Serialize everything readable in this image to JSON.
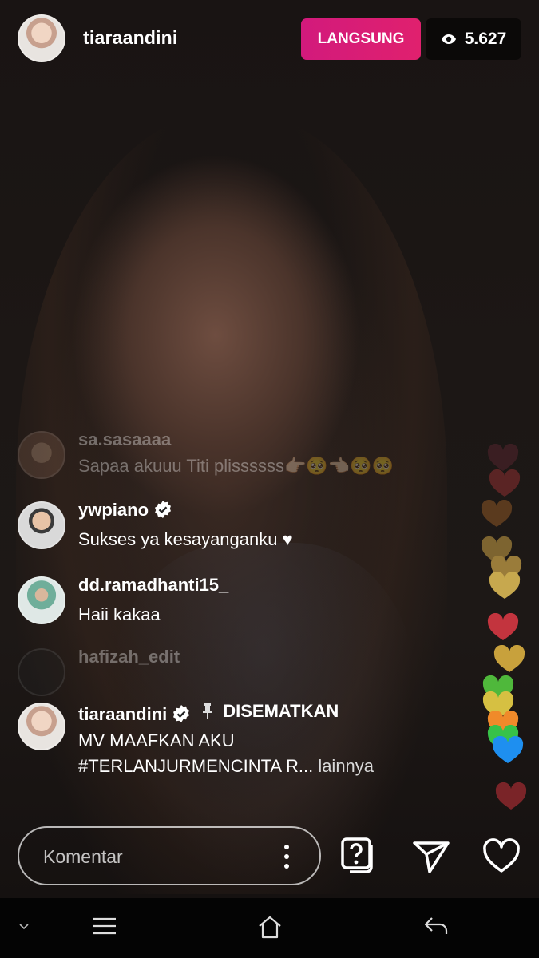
{
  "header": {
    "username": "tiaraandini",
    "live_label": "LANGSUNG",
    "viewer_count": "5.627",
    "viewer_icon": "eye-icon"
  },
  "comments": [
    {
      "username": "sa.sasaaaa",
      "text": "Sapaa akuuu Titi plissssss👉🏻🥺👈🏻🥺🥺",
      "faded": true
    },
    {
      "username": "ywpiano",
      "text": "Sukses ya kesayanganku ♥",
      "verified": true
    },
    {
      "username": "dd.ramadhanti15_",
      "text": "Haii kakaa"
    },
    {
      "username": "hafizah_edit",
      "text": "",
      "faded": true
    }
  ],
  "pinned_comment": {
    "username": "tiaraandini",
    "verified": true,
    "pinned_label": "DISEMATKAN",
    "line1": "MV MAAFKAN AKU",
    "line2": "#TERLANJURMENCINTA R...",
    "more_label": "lainnya"
  },
  "hearts_colors": [
    "#3a1e22",
    "#5a2424",
    "#5a3a1e",
    "#7d6430",
    "#9a7c3a",
    "#c7a84e",
    "#c3343e",
    "#c8a13c",
    "#4fb83b",
    "#d6c042",
    "#f08a2a",
    "#37c248",
    "#1e8ff0",
    "#7a2428"
  ],
  "bottom_bar": {
    "comment_placeholder": "Komentar",
    "question_icon": "question-box-icon",
    "share_icon": "paper-plane-icon",
    "like_icon": "heart-outline-icon"
  },
  "system_nav": {
    "icons": [
      "chevron-down-icon",
      "menu-icon",
      "home-icon",
      "back-icon"
    ]
  }
}
